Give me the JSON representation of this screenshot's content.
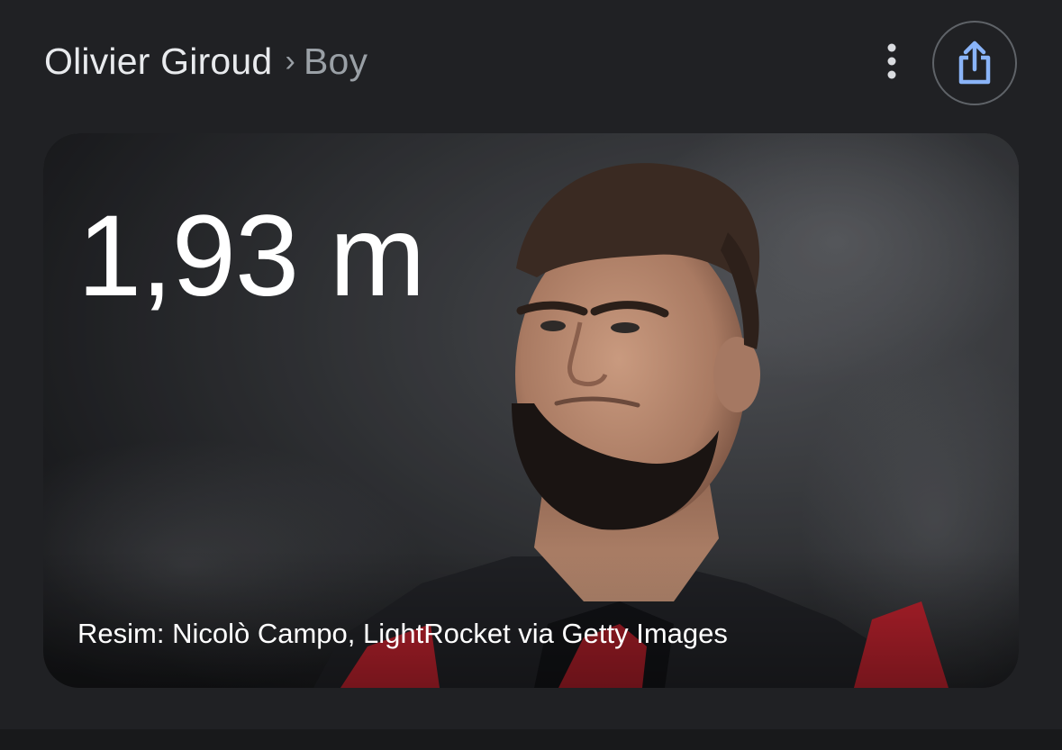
{
  "header": {
    "entity": "Olivier Giroud",
    "separator": "›",
    "attribute": "Boy",
    "more_icon": "more-vert-icon",
    "share_icon": "share-icon"
  },
  "card": {
    "height_value": "1,93 m",
    "credit": "Resim: Nicolò Campo, LightRocket via Getty Images"
  },
  "colors": {
    "background": "#202124",
    "share_accent": "#8ab4f8",
    "kit_red": "#c8202a"
  }
}
